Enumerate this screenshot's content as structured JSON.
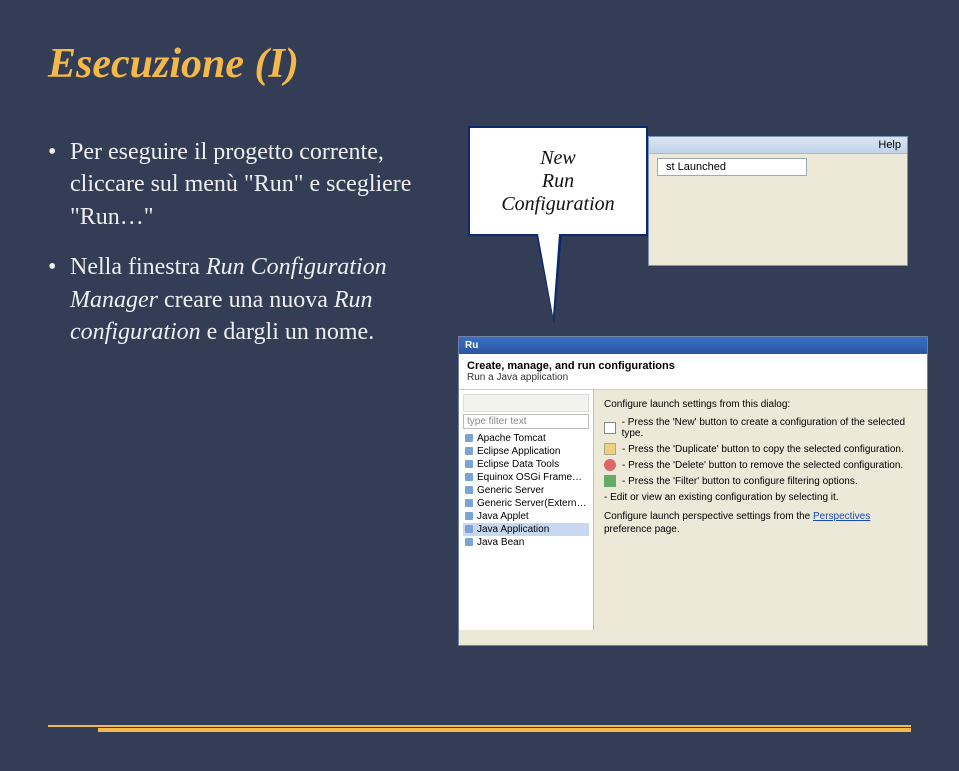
{
  "title": "Esecuzione (I)",
  "bullets": {
    "b1_pre": "Per eseguire il progetto corrente, cliccare sul menù \"Run\" e scegliere \"Run…\"",
    "b2_pre": "Nella finestra ",
    "b2_it1": "Run Configuration Manager",
    "b2_mid": " creare una nuova  ",
    "b2_it2": "Run configuration",
    "b2_post": " e dargli un nome."
  },
  "callout": {
    "line1": "New",
    "line2": "Run",
    "line3": "Configuration"
  },
  "shot1": {
    "menubar": "Help",
    "item1": "st Launched"
  },
  "shot2": {
    "title": "Ru",
    "header_h1": "Create, manage, and run configurations",
    "header_h2": "Run a Java application",
    "filter_placeholder": "type filter text",
    "tree": {
      "t0": "Apache Tomcat",
      "t1": "Eclipse Application",
      "t2": "Eclipse Data Tools",
      "t3": "Equinox OSGi Framework",
      "t4": "Generic Server",
      "t5": "Generic Server(External La",
      "t6": "Java Applet",
      "t7": "Java Application",
      "t8": "Java Bean"
    },
    "pane": {
      "p0": "Configure launch settings from this dialog:",
      "p1": "- Press the 'New' button to create a configuration of the selected type.",
      "p2": "- Press the 'Duplicate' button to copy the selected configuration.",
      "p3": "- Press the 'Delete' button to remove the selected configuration.",
      "p4": "- Press the 'Filter' button to configure filtering options.",
      "p5": "- Edit or view an existing configuration by selecting it.",
      "p6_pre": "Configure launch perspective settings from the ",
      "p6_link": "Perspectives",
      "p6_post": " preference page."
    }
  }
}
